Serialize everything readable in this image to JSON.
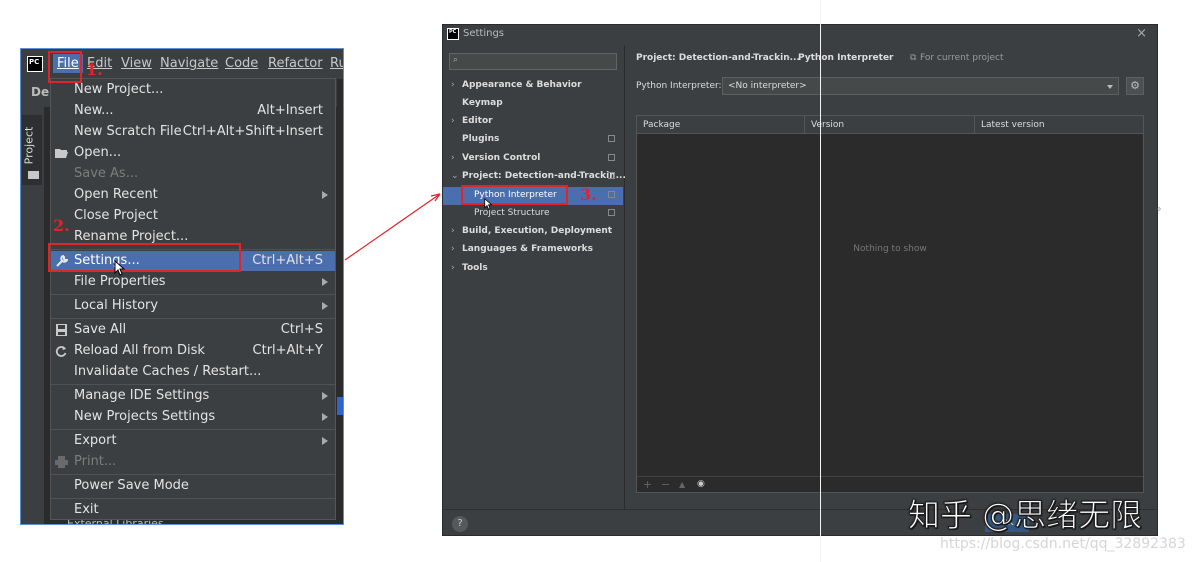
{
  "ide": {
    "logo": "PC",
    "menus": [
      {
        "label": "File",
        "mnemonic": "F"
      },
      {
        "label": "Edit"
      },
      {
        "label": "View"
      },
      {
        "label": "Navigate"
      },
      {
        "label": "Code"
      },
      {
        "label": "Refactor"
      },
      {
        "label": "Ru"
      }
    ],
    "project_row_text": "De",
    "side_tab_label": "Project",
    "bottom_text": "External Libraries",
    "file_menu": [
      {
        "label": "New Project...",
        "shortcut": ""
      },
      {
        "label": "New...",
        "shortcut": "Alt+Insert"
      },
      {
        "label": "New Scratch File",
        "shortcut": "Ctrl+Alt+Shift+Insert"
      },
      {
        "label": "Open...",
        "shortcut": "",
        "icon": "folder-open-icon"
      },
      {
        "label": "Save As...",
        "shortcut": "",
        "disabled": true
      },
      {
        "label": "Open Recent",
        "shortcut": "",
        "submenu": true
      },
      {
        "label": "Close Project",
        "shortcut": ""
      },
      {
        "label": "Rename Project...",
        "shortcut": ""
      },
      {
        "label": "Settings...",
        "shortcut": "Ctrl+Alt+S",
        "icon": "wrench-icon",
        "highlighted": true
      },
      {
        "label": "File Properties",
        "shortcut": "",
        "submenu": true
      },
      {
        "label": "Local History",
        "shortcut": "",
        "submenu": true
      },
      {
        "label": "Save All",
        "shortcut": "Ctrl+S",
        "icon": "save-icon"
      },
      {
        "label": "Reload All from Disk",
        "shortcut": "Ctrl+Alt+Y",
        "icon": "reload-icon"
      },
      {
        "label": "Invalidate Caches / Restart...",
        "shortcut": ""
      },
      {
        "label": "Manage IDE Settings",
        "shortcut": "",
        "submenu": true
      },
      {
        "label": "New Projects Settings",
        "shortcut": "",
        "submenu": true
      },
      {
        "label": "Export",
        "shortcut": "",
        "submenu": true
      },
      {
        "label": "Print...",
        "shortcut": "",
        "disabled": true,
        "icon": "print-icon"
      },
      {
        "label": "Power Save Mode",
        "shortcut": ""
      },
      {
        "label": "Exit",
        "shortcut": ""
      }
    ]
  },
  "annotations": {
    "step1": "1.",
    "step2": "2.",
    "step3": "3."
  },
  "settings": {
    "title": "Settings",
    "logo": "PC",
    "close": "×",
    "search_placeholder": "",
    "tree": [
      {
        "label": "Appearance & Behavior",
        "expandable": true
      },
      {
        "label": "Keymap"
      },
      {
        "label": "Editor",
        "expandable": true
      },
      {
        "label": "Plugins",
        "copy": true
      },
      {
        "label": "Version Control",
        "expandable": true,
        "copy": true
      },
      {
        "label": "Project: Detection-and-Trackin...",
        "expanded": true,
        "copy": true
      },
      {
        "label": "Python Interpreter",
        "child": true,
        "selected": true,
        "copy": true
      },
      {
        "label": "Project Structure",
        "child": true,
        "copy": true
      },
      {
        "label": "Build, Execution, Deployment",
        "expandable": true
      },
      {
        "label": "Languages & Frameworks",
        "expandable": true
      },
      {
        "label": "Tools",
        "expandable": true
      }
    ],
    "breadcrumb": {
      "project": "Project: Detection-and-Trackin...",
      "separator": "›",
      "page": "Python Interpreter",
      "scope": "For current project"
    },
    "interpreter_label": "Python Interpreter:",
    "interpreter_value": "<No interpreter>",
    "table": {
      "columns": [
        "Package",
        "Version",
        "Latest version"
      ],
      "empty": "Nothing to show"
    },
    "tools": [
      "+",
      "−",
      "▲",
      "◉"
    ],
    "help": "?",
    "ok": "OK"
  },
  "watermark": {
    "zhihu": "知乎 @思绪无限",
    "url": "https://blog.csdn.net/qq_32892383"
  },
  "stray_mark": "。"
}
